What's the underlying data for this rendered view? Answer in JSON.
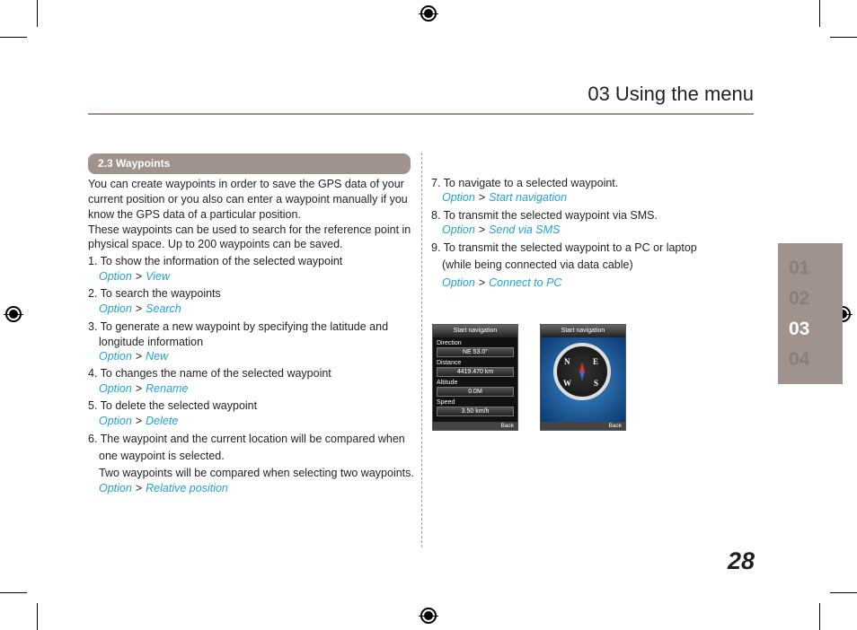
{
  "header": {
    "title": "03 Using the menu"
  },
  "section": {
    "title": "2.3  Waypoints"
  },
  "intro": [
    "You can create waypoints in order to save the GPS data of your",
    "current position or you also can enter a waypoint manually if you",
    "know the GPS data of a particular position.",
    "These waypoints can be used to search for the reference point in",
    "physical space. Up to 200 waypoints can be saved."
  ],
  "left_items": [
    {
      "lines": [
        "1. To show the information of the selected waypoint"
      ],
      "path": [
        "Option",
        "View"
      ]
    },
    {
      "lines": [
        "2. To search the waypoints"
      ],
      "path": [
        "Option",
        "Search"
      ]
    },
    {
      "lines": [
        "3. To generate a new waypoint by specifying the latitude and",
        "longitude information"
      ],
      "path": [
        "Option",
        "New"
      ]
    },
    {
      "lines": [
        "4. To changes the name of the selected waypoint"
      ],
      "path": [
        "Option",
        "Rename"
      ]
    },
    {
      "lines": [
        "5. To delete the selected waypoint"
      ],
      "path": [
        "Option",
        "Delete"
      ]
    },
    {
      "lines": [
        "6. The waypoint and the current location will be compared when",
        "one waypoint is selected.",
        "Two waypoints will be compared when selecting two waypoints."
      ],
      "path": [
        "Option",
        "Relative position"
      ]
    }
  ],
  "right_items": [
    {
      "lines": [
        "7. To navigate to a selected waypoint."
      ],
      "path": [
        "Option",
        "Start navigation"
      ]
    },
    {
      "lines": [
        "8. To transmit the selected waypoint via SMS."
      ],
      "path": [
        "Option",
        "Send via SMS"
      ]
    },
    {
      "lines": [
        "9. To transmit the selected waypoint to a PC or laptop",
        "(while being connected via data cable)"
      ],
      "path": [
        "Option",
        "Connect to PC"
      ]
    }
  ],
  "separator": ">",
  "screen1": {
    "title": "Start navigation",
    "fields": [
      {
        "label": "Direction",
        "value": "NE 53.0°"
      },
      {
        "label": "Distance",
        "value": "4419.470 km"
      },
      {
        "label": "Altitude",
        "value": "0.0M"
      },
      {
        "label": "Speed",
        "value": "3.50 km/h"
      }
    ],
    "back": "Back"
  },
  "screen2": {
    "title": "Start navigation",
    "compass": [
      "N",
      "E",
      "W",
      "S"
    ],
    "back": "Back"
  },
  "chapter_tabs": [
    {
      "label": "01",
      "active": false
    },
    {
      "label": "02",
      "active": false
    },
    {
      "label": "03",
      "active": true
    },
    {
      "label": "04",
      "active": false
    }
  ],
  "page_number": "28"
}
